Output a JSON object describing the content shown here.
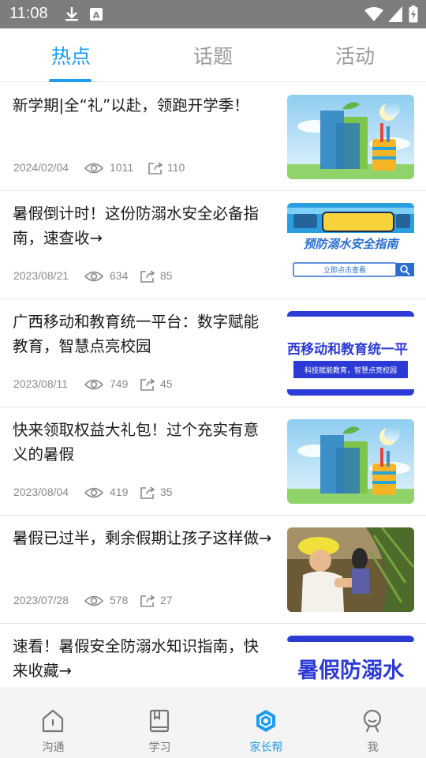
{
  "status_bar": {
    "time": "11:08",
    "left_icons": [
      "download-icon",
      "keyboard-a-icon"
    ],
    "right_icons": [
      "wifi-icon",
      "signal-icon",
      "battery-charging-icon"
    ]
  },
  "tabs": [
    {
      "label": "热点",
      "active": true
    },
    {
      "label": "话题",
      "active": false
    },
    {
      "label": "活动",
      "active": false
    }
  ],
  "accent_color": "#1e9cf0",
  "articles": [
    {
      "title": "新学期|全“礼”以赴，领跑开学季！",
      "date": "2024/02/04",
      "views": "1011",
      "shares": "110",
      "thumb": "books-illustration"
    },
    {
      "title": "暑假倒计时！这份防溺水安全必备指南，速查收→",
      "date": "2023/08/21",
      "views": "634",
      "shares": "85",
      "thumb": "drowning-guide-banner",
      "thumb_text": "预防溺水安全指南",
      "thumb_button": "立即点击查看"
    },
    {
      "title": "广西移动和教育统一平台：数字赋能教育，智慧点亮校园",
      "date": "2023/08/11",
      "views": "749",
      "shares": "45",
      "thumb": "platform-banner",
      "thumb_text": "西移动和教育统一平",
      "thumb_sub": "科技赋能教育，智慧点亮校园"
    },
    {
      "title": "快来领取权益大礼包！过个充实有意义的暑假",
      "date": "2023/08/04",
      "views": "419",
      "shares": "35",
      "thumb": "books-illustration"
    },
    {
      "title": "暑假已过半，剩余假期让孩子这样做→",
      "date": "2023/07/28",
      "views": "578",
      "shares": "27",
      "thumb": "child-photo"
    },
    {
      "title": "速看！暑假安全防溺水知识指南，快来收藏→",
      "date": "",
      "views": "",
      "shares": "",
      "thumb": "summer-banner",
      "thumb_text": "暑假防溺水"
    }
  ],
  "bottom_nav": [
    {
      "label": "沟通",
      "icon": "home-icon",
      "active": false
    },
    {
      "label": "学习",
      "icon": "book-icon",
      "active": false
    },
    {
      "label": "家长帮",
      "icon": "hexagon-icon",
      "active": true
    },
    {
      "label": "我",
      "icon": "profile-icon",
      "active": false
    }
  ]
}
